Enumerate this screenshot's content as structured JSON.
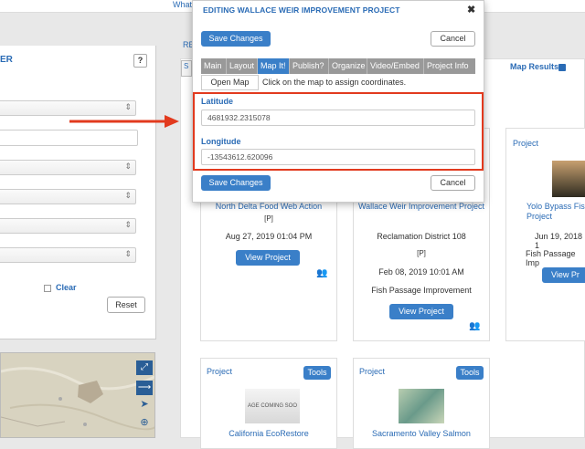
{
  "top_nav": {
    "label": "What"
  },
  "filter_panel": {
    "title": "ER",
    "help_label": "?",
    "clear_label": "Clear",
    "reset_label": "Reset"
  },
  "results": {
    "header_link": "RE",
    "tab_label": "S",
    "map_results_label": "Map Results"
  },
  "modal": {
    "title": "EDITING WALLACE WEIR IMPROVEMENT PROJECT",
    "close_icon": "✖",
    "save_label": "Save Changes",
    "cancel_label": "Cancel",
    "tabs": [
      {
        "label": "Main"
      },
      {
        "label": "Layout"
      },
      {
        "label": "Map It!"
      },
      {
        "label": "Publish?"
      },
      {
        "label": "Organize"
      },
      {
        "label": "Video/Embed"
      },
      {
        "label": "Project Info"
      }
    ],
    "active_tab": "Map It!",
    "open_map_label": "Open Map",
    "map_hint": "Click on the map to assign coordinates.",
    "latitude_label": "Latitude",
    "latitude_value": "4681932.2315078",
    "longitude_label": "Longitude",
    "longitude_value": "-13543612.620096",
    "highlight_color": "#e23a1e"
  },
  "cards": [
    {
      "title": "North Delta Food Web Action",
      "tag": "[P]",
      "date": "Aug 27, 2019 01:04 PM",
      "button": "View Project"
    },
    {
      "title": "Wallace Weir Improvement Project",
      "org": "Reclamation District 108",
      "tag": "[P]",
      "date": "Feb 08, 2019 10:01 AM",
      "category": "Fish Passage Improvement",
      "button": "View Project"
    },
    {
      "label": "Project",
      "title": "Yolo Bypass Fish Project",
      "date": "Jun 19, 2018 1",
      "category": "Fish Passage Imp",
      "button": "View Pr"
    },
    {
      "label": "Project",
      "tools": "Tools",
      "image_text": "AGE COMING SOO",
      "title": "California EcoRestore"
    },
    {
      "label": "Project",
      "tools": "Tools",
      "title": "Sacramento Valley Salmon"
    }
  ],
  "colors": {
    "accent": "#2a6bb5",
    "button": "#3a7fc8"
  }
}
